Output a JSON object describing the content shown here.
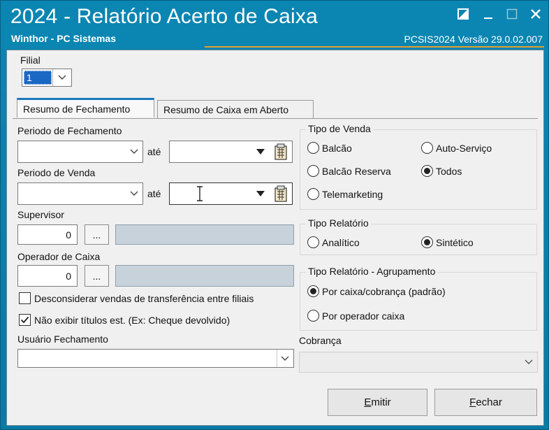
{
  "window": {
    "title": "2024 - Relatório Acerto de Caixa",
    "subtitle": "Winthor - PC Sistemas",
    "version": "PCSIS2024  Versão  29.0.02.007"
  },
  "filial": {
    "label": "Filial",
    "value": "1"
  },
  "tabs": [
    {
      "label": "Resumo de Fechamento",
      "active": true
    },
    {
      "label": "Resumo de Caixa em Aberto",
      "active": false
    }
  ],
  "periodo_fechamento": {
    "label": "Periodo de Fechamento",
    "ate": "até",
    "start": "",
    "end": ""
  },
  "periodo_venda": {
    "label": "Periodo de Venda",
    "ate": "até",
    "start": "",
    "end": ""
  },
  "supervisor": {
    "label": "Supervisor",
    "value": "0",
    "dots": "...",
    "name": ""
  },
  "operador": {
    "label": "Operador de Caixa",
    "value": "0",
    "dots": "...",
    "name": ""
  },
  "checks": [
    {
      "label": "Desconsiderar vendas de transferência entre filiais",
      "checked": false
    },
    {
      "label": "Não exibir títulos est. (Ex: Cheque devolvido)",
      "checked": true
    }
  ],
  "usuario_fechamento": {
    "label": "Usuário Fechamento",
    "value": ""
  },
  "tipo_venda": {
    "title": "Tipo de Venda",
    "options": [
      {
        "label": "Balcão",
        "selected": false
      },
      {
        "label": "Auto-Serviço",
        "selected": false
      },
      {
        "label": "Balcão Reserva",
        "selected": false
      },
      {
        "label": "Todos",
        "selected": true
      },
      {
        "label": "Telemarketing",
        "selected": false
      }
    ]
  },
  "tipo_relatorio": {
    "title": "Tipo Relatório",
    "options": [
      {
        "label": "Analítico",
        "selected": false
      },
      {
        "label": "Sintético",
        "selected": true
      }
    ]
  },
  "agrupamento": {
    "title": "Tipo Relatório - Agrupamento",
    "options": [
      {
        "label": "Por caixa/cobrança (padrão)",
        "selected": true
      },
      {
        "label": "Por operador caixa",
        "selected": false
      }
    ]
  },
  "cobranca": {
    "label": "Cobrança",
    "value": ""
  },
  "buttons": {
    "emitir_first": "E",
    "emitir_rest": "mitir",
    "fechar_first": "F",
    "fechar_rest": "echar"
  },
  "colors": {
    "titlebar": "#0a7ea8",
    "accent_line": "#e3a22c",
    "tab_active": "#1c78c0",
    "readonly_field": "#c7d2db",
    "filial_selected": "#1a68c4"
  },
  "icons": [
    "restore-icon",
    "minimize-icon",
    "maximize-icon",
    "close-icon",
    "dropdown-arrow-icon",
    "calendar-icon",
    "text-cursor-icon"
  ]
}
